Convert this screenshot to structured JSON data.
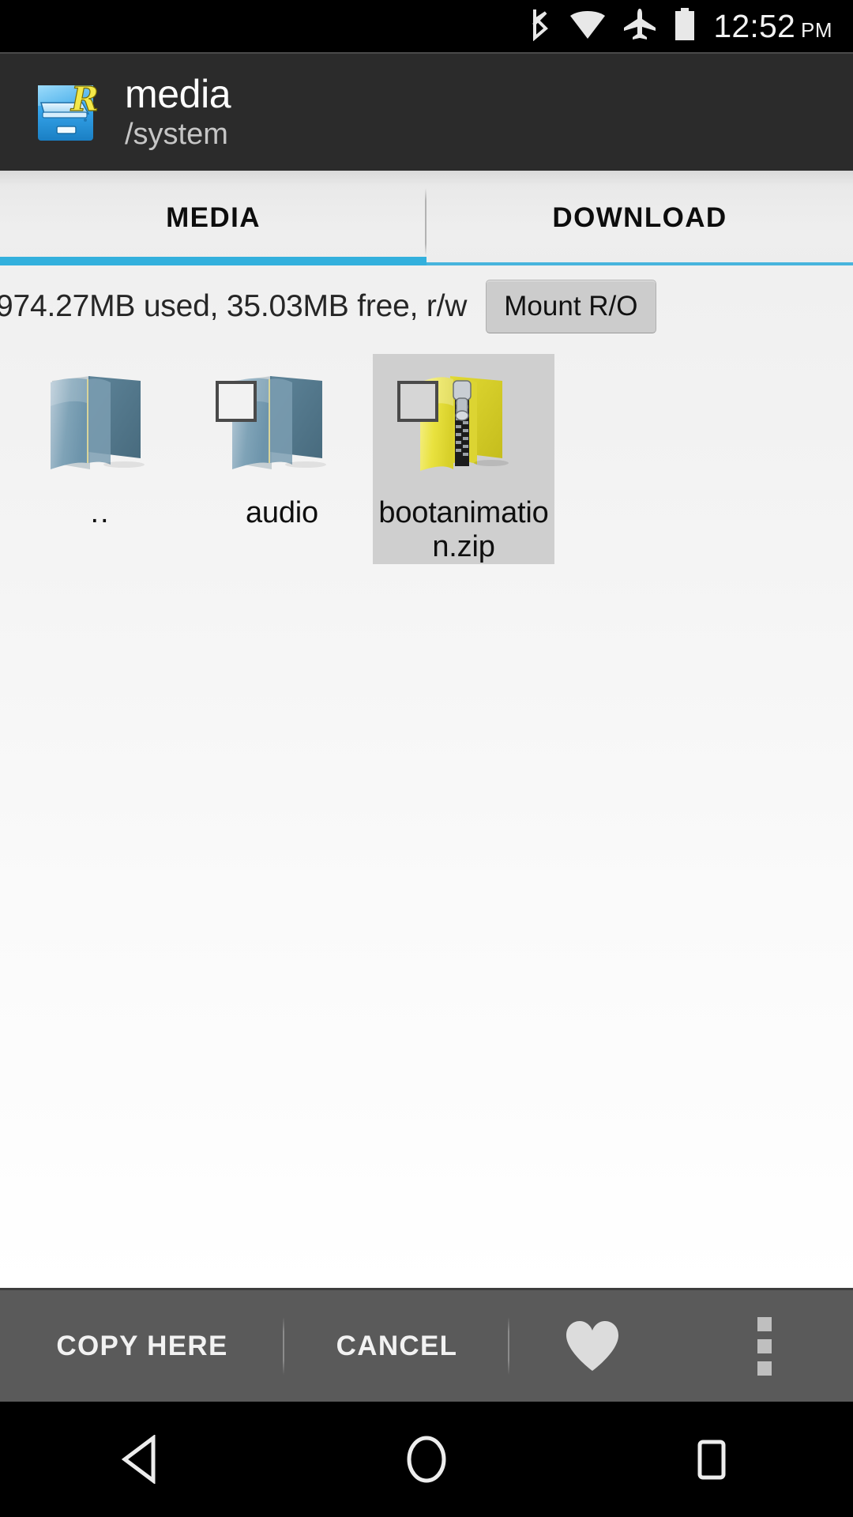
{
  "status_bar": {
    "time": "12:52",
    "ampm": "PM",
    "icons": [
      "bluetooth-icon",
      "wifi-icon",
      "airplane-mode-icon",
      "battery-icon"
    ]
  },
  "header": {
    "app_icon": "root-explorer-icon",
    "title": "media",
    "subtitle": "/system"
  },
  "tabs": [
    {
      "label": "MEDIA",
      "active": true
    },
    {
      "label": "DOWNLOAD",
      "active": false
    }
  ],
  "storage": {
    "info": "974.27MB used, 35.03MB free, r/w",
    "used": "974.27MB",
    "free": "35.03MB",
    "mode": "r/w",
    "mount_button_label": "Mount R/O"
  },
  "files": [
    {
      "name": "..",
      "type": "parent-folder",
      "checkbox": false,
      "selected": false
    },
    {
      "name": "audio",
      "type": "folder",
      "checkbox": true,
      "selected": false
    },
    {
      "name": "bootanimation.zip",
      "type": "zip",
      "checkbox": true,
      "selected": true
    }
  ],
  "action_bar": {
    "copy_label": "COPY HERE",
    "cancel_label": "CANCEL",
    "favorite_icon": "heart-icon",
    "overflow_icon": "overflow-menu-icon"
  },
  "nav_bar": {
    "back": "back-icon",
    "home": "home-icon",
    "recents": "recents-icon"
  },
  "colors": {
    "accent": "#33b0dd",
    "status_bar_bg": "#000000",
    "header_bg": "#2b2b2b",
    "action_bar_bg": "#5a5a5a",
    "selection_bg": "#cfcfcf"
  }
}
